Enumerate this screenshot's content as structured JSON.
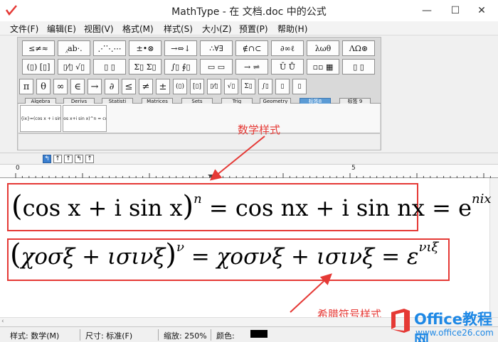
{
  "window": {
    "title": "MathType - 在 文档.doc 中的公式",
    "min_glyph": "—",
    "max_glyph": "☐",
    "close_glyph": "✕"
  },
  "menu": [
    {
      "label": "文件(F)"
    },
    {
      "label": "编辑(E)"
    },
    {
      "label": "视图(V)"
    },
    {
      "label": "格式(M)"
    },
    {
      "label": "样式(S)"
    },
    {
      "label": "大小(Z)"
    },
    {
      "label": "预置(P)"
    },
    {
      "label": "帮助(H)"
    }
  ],
  "palette_row1": [
    "≤≠≈",
    "⁁ab·.",
    "⋰⋱⋯",
    "±•⊗",
    "→⇔↓",
    "∴∀∃",
    "∉∩⊂",
    "∂∞ℓ",
    "λωθ",
    "ΛΩ⊛"
  ],
  "palette_row2": [
    "(▯) [▯]",
    "▯⁄▯ √▯",
    "▯ ▯",
    "Σ▯ Σ▯",
    "∫▯ ∮▯",
    "▭ ▭",
    "→ ⇌",
    "Ū Ů",
    "▫▫ ▦",
    "▯ ▯"
  ],
  "small_row": [
    "π",
    "θ",
    "∞",
    "∈",
    "→",
    "∂",
    "≤",
    "≠",
    "±",
    "(▯)",
    "[▯]",
    "▯⁄▯",
    "√▯",
    "Σ▯",
    "∫▯",
    "▯",
    "▯"
  ],
  "tabs": [
    "Algebra",
    "Derivs",
    "Statisti",
    "Matrices",
    "Sets",
    "Trig",
    "Geometry",
    "标签8",
    "标签 9"
  ],
  "templates": [
    "e^{ix}=(cos x + i sin x)",
    "(cos x+i sin x)^n = cos"
  ],
  "nest_buttons": [
    "↰",
    "↑",
    "↑",
    "↰",
    "↑"
  ],
  "ruler": {
    "label_start": "0",
    "label_mid": "5"
  },
  "equations": {
    "eq1": {
      "lhs_open": "(",
      "lhs_body": "cos x + i sin x",
      "lhs_close": ")",
      "lhs_exp": "n",
      "rhs": "= cos nx + i sin nx = e",
      "rhs_exp": "nix"
    },
    "eq2": {
      "lhs_open": "(",
      "lhs_body": "χοσξ + ισινξ",
      "lhs_close": ")",
      "lhs_exp": "ν",
      "rhs": "= χοσνξ + ισινξ = ε",
      "rhs_exp": "νιξ"
    }
  },
  "annotations": {
    "math_style": "数学样式",
    "greek_style": "希腊符号样式"
  },
  "status": {
    "style": "样式: 数学(M)",
    "size": "尺寸: 标准(F)",
    "zoom": "缩放: 250%",
    "color_label": "颜色:",
    "color_value": "#000000"
  },
  "watermark": {
    "title": "Office教程网",
    "url": "www.office26.com"
  },
  "colors": {
    "annotation_red": "#e53935",
    "active_tab": "#5b9bd5",
    "watermark_blue": "#1e88e5"
  }
}
